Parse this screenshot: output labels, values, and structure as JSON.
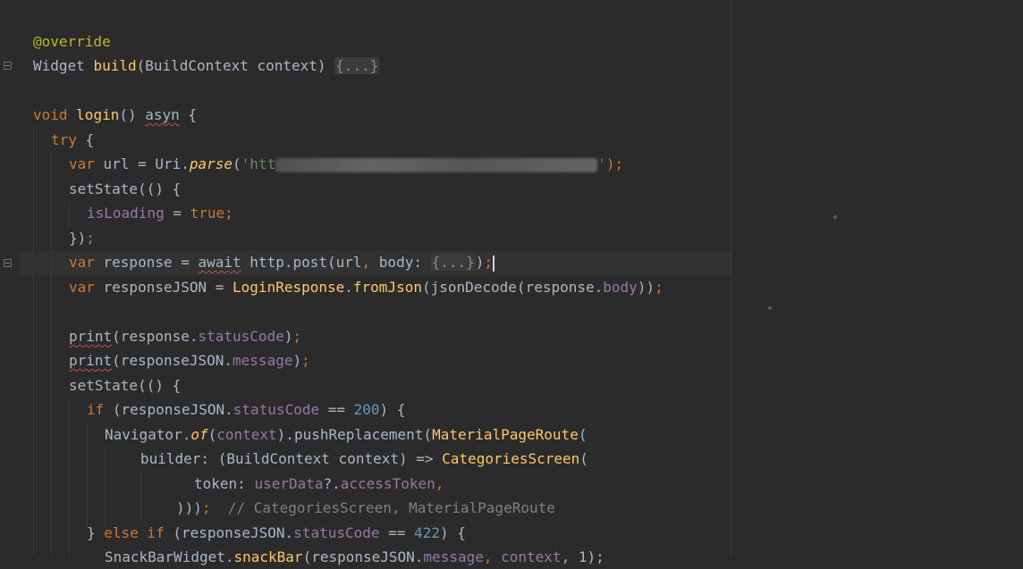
{
  "editor": {
    "lines": {
      "l1": [
        "@override"
      ],
      "l2": [
        "Widget ",
        "build",
        "(BuildContext context) ",
        "{...}"
      ],
      "l4": [
        "void ",
        "login",
        "() ",
        "asyn",
        " {"
      ],
      "l5": [
        "try",
        " {"
      ],
      "l6": [
        "var ",
        "url = Uri.",
        "parse",
        "(",
        "'htt",
        "",
        "'",
        ");"
      ],
      "l7": [
        "setState(() {"
      ],
      "l8": [
        "isLoading",
        " = ",
        "true",
        ";"
      ],
      "l9": [
        "})",
        ";"
      ],
      "l10": [
        "var ",
        "response = ",
        "await",
        " http.post(url",
        ", ",
        "body: ",
        "{...}",
        ")",
        ";"
      ],
      "l11": [
        "var ",
        "responseJSON = ",
        "LoginResponse",
        ".",
        "fromJson",
        "(jsonDecode(response.",
        "body",
        "))",
        ";"
      ],
      "l13": [
        "print",
        "(response.",
        "statusCode",
        ")",
        ";"
      ],
      "l14": [
        "print",
        "(responseJSON.",
        "message",
        ")",
        ";"
      ],
      "l15": [
        "setState(() {"
      ],
      "l16": [
        "if ",
        "(responseJSON.",
        "statusCode",
        " == ",
        "200",
        ") {"
      ],
      "l17": [
        "Navigator.",
        "of",
        "(",
        "context",
        ").pushReplacement(",
        "MaterialPageRoute",
        "("
      ],
      "l18": [
        "builder: (BuildContext context) => ",
        "CategoriesScreen",
        "("
      ],
      "l19": [
        "token: ",
        "userData",
        "?.",
        "accessToken",
        ","
      ],
      "l20": [
        ")))",
        ";",
        "  // CategoriesScreen, MaterialPageRoute"
      ],
      "l21": [
        "} ",
        "else if ",
        "(responseJSON.",
        "statusCode",
        " == ",
        "422",
        ") {"
      ],
      "l22": [
        "SnackBarWidget.",
        "snackBar",
        "(responseJSON.",
        "message",
        ", ",
        "context",
        ", 1);"
      ]
    }
  },
  "colors": {
    "background": "#2b2b2b",
    "keyword": "#cc7832",
    "function": "#ffc66d",
    "string": "#6a8759",
    "number": "#6897bb",
    "annotation": "#bbb529",
    "field": "#9876aa",
    "comment": "#808080",
    "text": "#a9b7c6"
  },
  "icons": {
    "fold": "fold-toggle-icon"
  }
}
